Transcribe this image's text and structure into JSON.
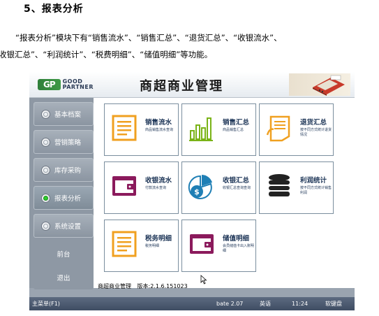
{
  "doc": {
    "heading": "5、报表分析",
    "intro_line1": "“报表分析”模块下有“销售流水”、“销售汇总”、“退货汇总”、“收银流水”、",
    "intro_line2": "“收银汇总”、“利润统计”、“税费明细”、“储值明细”等功能。"
  },
  "app": {
    "logo_badge": "GP",
    "logo_word1": "GOOD",
    "logo_word2": "PARTNER",
    "title": "商超商业管理"
  },
  "sidebar": {
    "items": [
      {
        "label": "基本档案",
        "radio": true,
        "selected": false
      },
      {
        "label": "营销策略",
        "radio": true,
        "selected": false
      },
      {
        "label": "库存采购",
        "radio": true,
        "selected": false
      },
      {
        "label": "报表分析",
        "radio": true,
        "selected": true
      },
      {
        "label": "系统设置",
        "radio": true,
        "selected": false
      },
      {
        "label": "前台",
        "radio": false,
        "selected": false
      },
      {
        "label": "退出",
        "radio": false,
        "selected": false
      }
    ]
  },
  "tiles": [
    {
      "name": "销售流水",
      "desc": "商品销售流水查询",
      "icon": "document-lines-icon",
      "color": "#f0a020"
    },
    {
      "name": "销售汇总",
      "desc": "商品销售汇总",
      "icon": "bar-chart-icon",
      "color": "#7ab317"
    },
    {
      "name": "退货汇总",
      "desc": "按不同方式统计退货情况",
      "icon": "return-form-icon",
      "color": "#f0a020"
    },
    {
      "name": "收银流水",
      "desc": "付款流水查询",
      "icon": "wallet-icon",
      "color": "#8b1a5c"
    },
    {
      "name": "收银汇总",
      "desc": "收银汇总查询查询",
      "icon": "pie-dollar-icon",
      "color": "#1f7fb5"
    },
    {
      "name": "利润统计",
      "desc": "按不同方式统计销售利润",
      "icon": "coin-stack-icon",
      "color": "#222222"
    },
    {
      "name": "税务明细",
      "desc": "税务明细",
      "icon": "document-lines-icon",
      "color": "#f0a020"
    },
    {
      "name": "储值明细",
      "desc": "会员储值卡出入账明细",
      "icon": "wallet-icon",
      "color": "#8b1a5c"
    }
  ],
  "version": {
    "app": "商超商业管理",
    "label": "版本:2.1.6.151023"
  },
  "statusbar": {
    "menu": "主菜单(F1)",
    "build": "bate 2.07",
    "lang": "英语",
    "time": "11:24",
    "keyboard": "软键盘"
  }
}
